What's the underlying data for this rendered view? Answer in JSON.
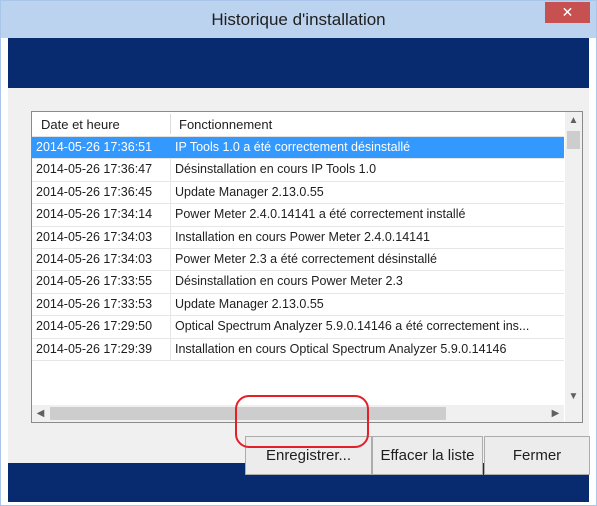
{
  "window": {
    "title": "Historique d'installation",
    "close_glyph": "✕"
  },
  "table": {
    "headers": [
      "Date et heure",
      "Fonctionnement"
    ],
    "rows": [
      {
        "date": "2014-05-26 17:36:51",
        "op": "IP Tools 1.0 a été correctement désinstallé",
        "selected": true
      },
      {
        "date": "2014-05-26 17:36:47",
        "op": "Désinstallation en cours IP Tools 1.0"
      },
      {
        "date": "2014-05-26 17:36:45",
        "op": "Update Manager 2.13.0.55"
      },
      {
        "date": "2014-05-26 17:34:14",
        "op": "Power Meter 2.4.0.14141 a été correctement installé"
      },
      {
        "date": "2014-05-26 17:34:03",
        "op": "Installation en cours Power Meter 2.4.0.14141"
      },
      {
        "date": "2014-05-26 17:34:03",
        "op": "Power Meter 2.3 a été correctement désinstallé"
      },
      {
        "date": "2014-05-26 17:33:55",
        "op": "Désinstallation en cours Power Meter 2.3"
      },
      {
        "date": "2014-05-26 17:33:53",
        "op": "Update Manager 2.13.0.55"
      },
      {
        "date": "2014-05-26 17:29:50",
        "op": "Optical Spectrum Analyzer 5.9.0.14146 a été correctement ins..."
      },
      {
        "date": "2014-05-26 17:29:39",
        "op": "Installation en cours Optical Spectrum Analyzer 5.9.0.14146"
      }
    ]
  },
  "buttons": {
    "save": "Enregistrer...",
    "clear": "Effacer la liste",
    "close": "Fermer"
  },
  "icons": {
    "scroll_up": "chevron-up-icon",
    "scroll_down": "chevron-down-icon",
    "scroll_left": "chevron-left-icon",
    "scroll_right": "chevron-right-icon"
  },
  "colors": {
    "titlebar": "#bcd3f0",
    "frame": "#082a6e",
    "selection": "#3399ff",
    "close": "#c75050",
    "highlight": "#e3202a"
  }
}
